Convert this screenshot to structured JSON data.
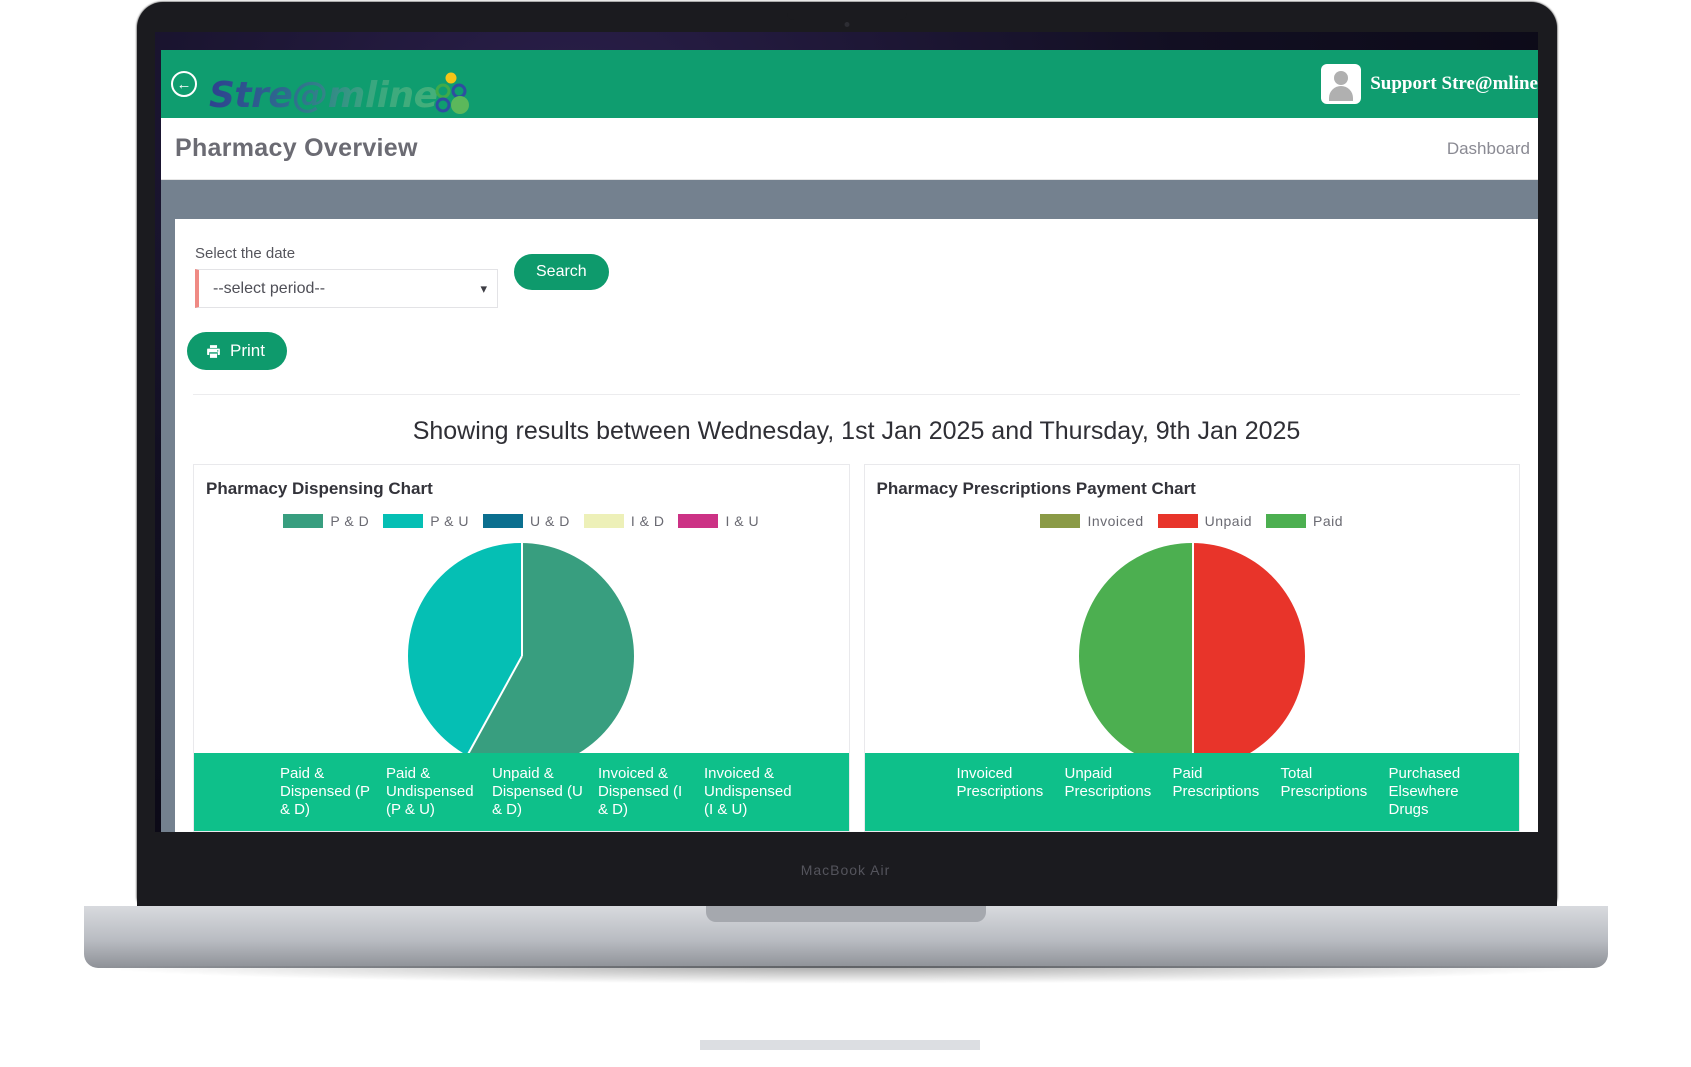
{
  "device": {
    "label": "MacBook Air"
  },
  "topbar": {
    "back_icon": "back-arrow-icon",
    "brand": "Stre@mline",
    "user_name": "Support Stre@mline",
    "avatar_icon": "user-avatar-icon"
  },
  "header": {
    "page_title": "Pharmacy Overview",
    "breadcrumb": "Dashboard"
  },
  "filters": {
    "date_label": "Select the date",
    "date_value": "--select period--",
    "date_caret_icon": "chevron-down-icon",
    "search_label": "Search",
    "print_label": "Print",
    "print_icon": "printer-icon"
  },
  "results": {
    "heading": "Showing results between Wednesday, 1st Jan 2025 and Thursday, 9th Jan 2025"
  },
  "dispensing": {
    "title": "Pharmacy Dispensing Chart",
    "columns": [
      "Paid & Dispensed (P & D)",
      "Paid & Undispensed (P & U)",
      "Unpaid & Dispensed (U & D)",
      "Invoiced & Dispensed (I & D)",
      "Invoiced & Undispensed (I & U)"
    ]
  },
  "payment": {
    "title": "Pharmacy Prescriptions Payment Chart",
    "columns": [
      "Invoiced Prescriptions",
      "Unpaid Prescriptions",
      "Paid Prescriptions",
      "Total Prescriptions",
      "Purchased Elsewhere Drugs"
    ]
  },
  "colors": {
    "brand_green": "#0f9d6f",
    "table_green": "#0ec08a",
    "grey_bar": "#74818f",
    "accent_red": "#ef8a84"
  },
  "chart_data": [
    {
      "type": "pie",
      "title": "Pharmacy Dispensing Chart",
      "legend_position": "top",
      "labels": [
        "P & D",
        "P & U",
        "U & D",
        "I & D",
        "I & U"
      ],
      "full_labels": [
        "Paid & Dispensed (P & D)",
        "Paid & Undispensed (P & U)",
        "Unpaid & Dispensed (U & D)",
        "Invoiced & Dispensed (I & D)",
        "Invoiced & Undispensed (I & U)"
      ],
      "values": [
        58,
        42,
        0,
        0,
        0
      ],
      "colors": [
        "#389e7f",
        "#05bfb4",
        "#0b6f8f",
        "#edf0b8",
        "#cc3285"
      ]
    },
    {
      "type": "pie",
      "title": "Pharmacy Prescriptions Payment Chart",
      "legend_position": "top",
      "labels": [
        "Invoiced",
        "Unpaid",
        "Paid"
      ],
      "full_labels": [
        "Invoiced Prescriptions",
        "Unpaid Prescriptions",
        "Paid Prescriptions"
      ],
      "values": [
        0,
        50,
        50
      ],
      "colors": [
        "#8a9a46",
        "#e8342a",
        "#4caf50"
      ]
    }
  ]
}
